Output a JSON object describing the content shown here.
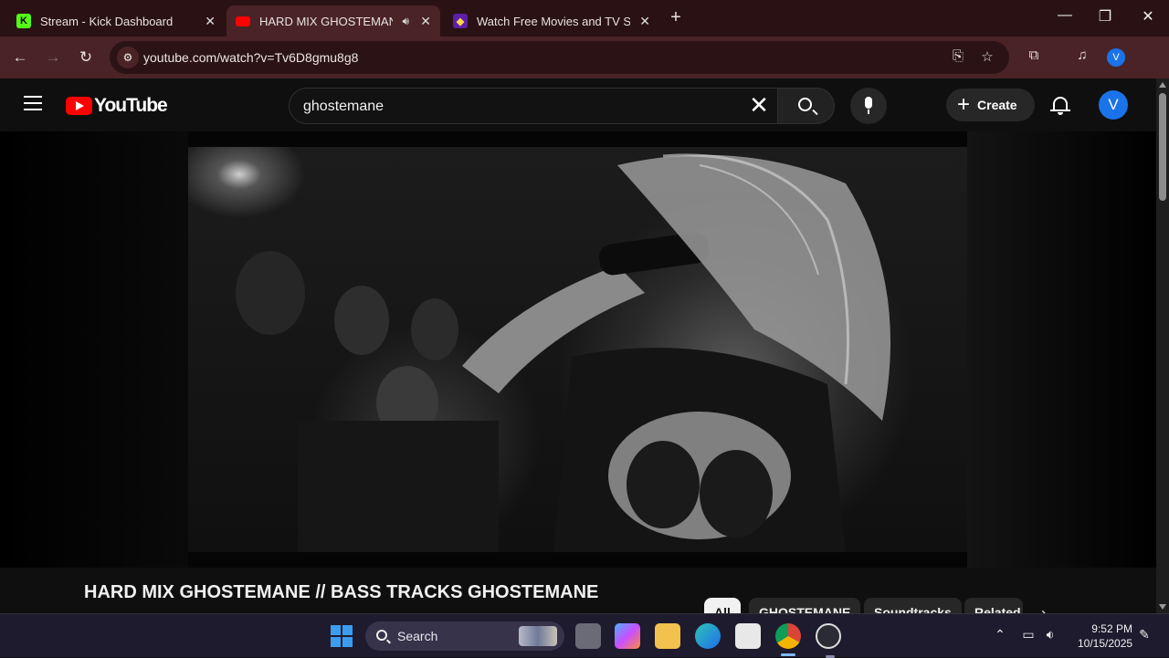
{
  "browser": {
    "tabs": [
      {
        "title": "Stream - Kick Dashboard",
        "favicon": "K"
      },
      {
        "title": "HARD MIX GHOSTEMANE / BASS TRACKS GHOSTEMANE",
        "favicon": "youtube-icon"
      },
      {
        "title": "Watch Free Movies and TV Shows",
        "favicon": "purple-app-icon"
      }
    ],
    "address": "youtube.com/watch?v=Tv6D8gmu8g8",
    "profile_initial": "V"
  },
  "youtube": {
    "logo_text": "YouTube",
    "search_query": "ghostemane",
    "create_label": "Create",
    "avatar_initial": "V"
  },
  "video": {
    "title": "HARD MIX GHOSTEMANE // BASS TRACKS GHOSTEMANE",
    "chips": [
      "All",
      "GHOSTEMANE",
      "Soundtracks",
      "Related"
    ]
  },
  "taskbar": {
    "search_label": "Search",
    "time": "9:52 PM",
    "date": "10/15/2025"
  },
  "colors": {
    "chrome_tab_bar": "#2a1214",
    "chrome_toolbar": "#4a2326",
    "youtube_red": "#ff0000",
    "background": "#0f0f0f"
  }
}
